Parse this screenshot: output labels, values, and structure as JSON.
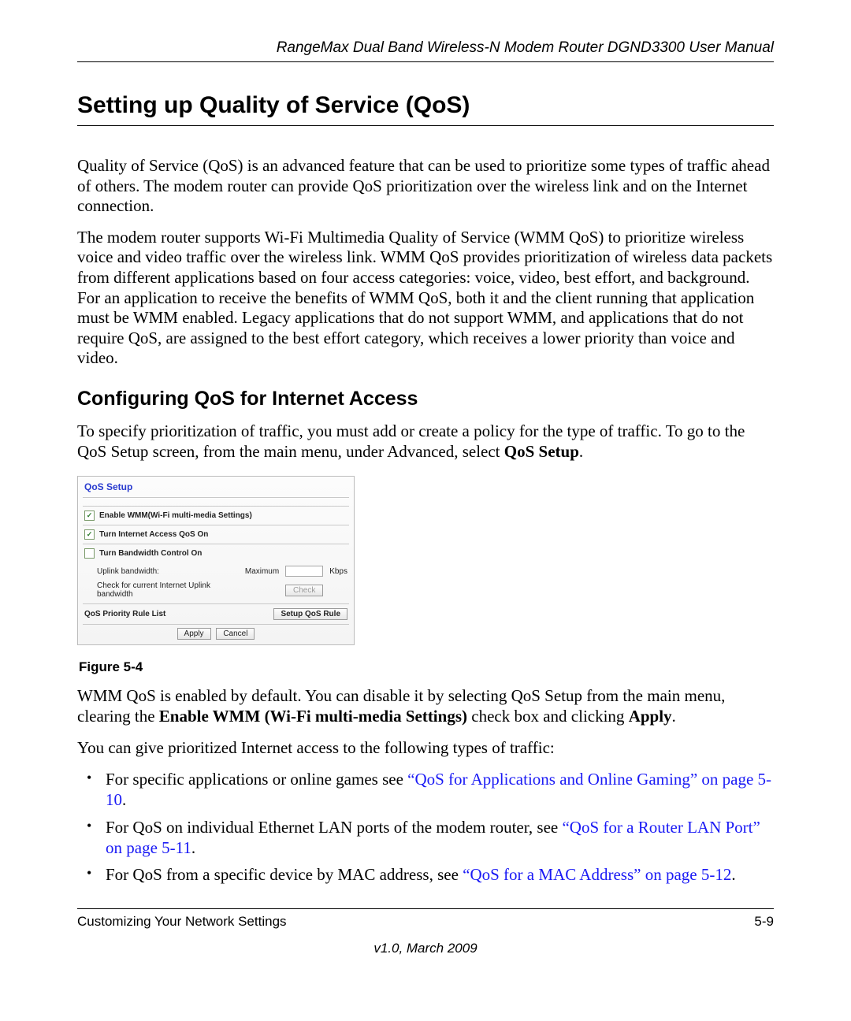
{
  "header": {
    "running": "RangeMax Dual Band Wireless-N Modem Router DGND3300 User Manual"
  },
  "section": {
    "title": "Setting up Quality of Service (QoS)",
    "para1": "Quality of Service (QoS) is an advanced feature that can be used to prioritize some types of traffic ahead of others. The modem router can provide QoS prioritization over the wireless link and on the Internet connection.",
    "para2": "The modem router supports Wi-Fi Multimedia Quality of Service (WMM QoS) to prioritize wireless voice and video traffic over the wireless link. WMM QoS provides prioritization of wireless data packets from different applications based on four access categories: voice, video, best effort, and background. For an application to receive the benefits of WMM QoS, both it and the client running that application must be WMM enabled. Legacy applications that do not support WMM, and applications that do not require QoS, are assigned to the best effort category, which receives a lower priority than voice and video."
  },
  "subsection": {
    "title": "Configuring QoS for Internet Access",
    "para1_a": "To specify prioritization of traffic, you must add or create a policy for the type of traffic. To go to the QoS Setup screen, from the main menu, under Advanced, select ",
    "para1_bold": "QoS Setup",
    "para1_b": "."
  },
  "qos_panel": {
    "title": "QoS Setup",
    "enable_wmm": "Enable WMM(Wi-Fi multi-media Settings)",
    "turn_internet": "Turn Internet Access QoS On",
    "turn_bw": "Turn Bandwidth Control On",
    "uplink_label": "Uplink bandwidth:",
    "maximum": "Maximum",
    "kbps": "Kbps",
    "check_label": "Check for current Internet Uplink bandwidth",
    "check_btn": "Check",
    "rule_list": "QoS Priority Rule List",
    "setup_rule_btn": "Setup QoS Rule",
    "apply": "Apply",
    "cancel": "Cancel"
  },
  "figure_caption": "Figure 5-4",
  "post_figure": {
    "p1_a": "WMM QoS is enabled by default. You can disable it by selecting QoS Setup from the main menu, clearing the ",
    "p1_bold1": "Enable WMM (Wi-Fi multi-media Settings)",
    "p1_mid": " check box and clicking ",
    "p1_bold2": "Apply",
    "p1_end": ".",
    "p2": "You can give prioritized Internet access to the following types of traffic:"
  },
  "bullets": {
    "b1_a": "For specific applications or online games see ",
    "b1_link": "“QoS for Applications and Online Gaming” on page 5-10",
    "b1_end": ".",
    "b2_a": "For QoS on individual Ethernet LAN ports of the modem router, see ",
    "b2_link": "“QoS for a Router LAN Port” on page 5-11",
    "b2_end": ".",
    "b3_a": "For QoS from a specific device by MAC address, see ",
    "b3_link": "“QoS for a MAC Address” on page 5-12",
    "b3_end": "."
  },
  "footer": {
    "left": "Customizing Your Network Settings",
    "right": "5-9",
    "version": "v1.0, March 2009"
  }
}
